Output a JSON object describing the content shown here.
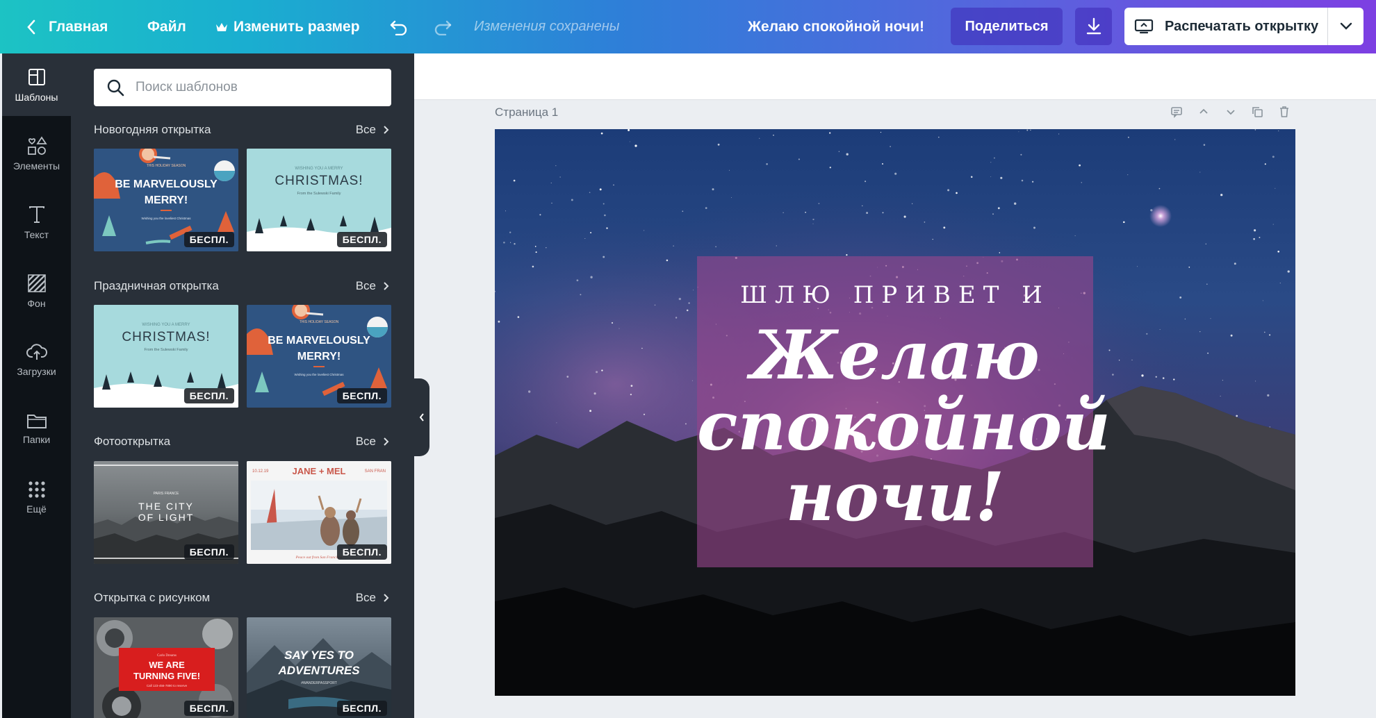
{
  "topbar": {
    "home_label": "Главная",
    "file_label": "Файл",
    "resize_label": "Изменить размер",
    "saved_status": "Изменения сохранены",
    "doc_title": "Желаю спокойной ночи!",
    "share_label": "Поделиться",
    "print_label": "Распечатать открытку"
  },
  "rail": {
    "items": [
      {
        "label": "Шаблоны",
        "icon": "templates-icon"
      },
      {
        "label": "Элементы",
        "icon": "elements-icon"
      },
      {
        "label": "Текст",
        "icon": "text-icon"
      },
      {
        "label": "Фон",
        "icon": "background-icon"
      },
      {
        "label": "Загрузки",
        "icon": "upload-icon"
      },
      {
        "label": "Папки",
        "icon": "folder-icon"
      },
      {
        "label": "Ещё",
        "icon": "more-icon"
      }
    ]
  },
  "panel": {
    "search_placeholder": "Поиск шаблонов",
    "all_label": "Все",
    "badge_label": "БЕСПЛ.",
    "sections": [
      {
        "title": "Новогодняя открытка"
      },
      {
        "title": "Праздничная открытка"
      },
      {
        "title": "Фотооткрытка"
      },
      {
        "title": "Открытка с рисунком"
      }
    ],
    "thumbs": {
      "merry_small": "THIS HOLIDAY SEASON",
      "merry_line1": "BE MARVELOUSLY",
      "merry_line2": "MERRY!",
      "merry_foot": "Wishing you the loveliest Christmas",
      "xmas_small": "WISHING YOU A MERRY",
      "xmas_big": "CHRISTMAS!",
      "xmas_foot": "From the Sulewski Family",
      "city_small": "PARIS FRANCE",
      "city_line1": "THE CITY",
      "city_line2": "OF LIGHT",
      "jm_date": "10.12.19",
      "jm_names": "JANE + MEL",
      "jm_place": "SAN FRAN",
      "jm_foot": "Peace out from San Francisco",
      "five_small": "Carlo Dreams",
      "five_line1": "WE ARE",
      "five_line2": "TURNING FIVE!",
      "five_foot": "Call 123-456-7890 to reserve",
      "adv_line1": "SAY YES TO",
      "adv_line2": "ADVENTURES",
      "adv_foot": "#WANDERPASSPORT"
    }
  },
  "canvas": {
    "page_label": "Страница 1",
    "greeting_small": "ШЛЮ ПРИВЕТ И",
    "greeting_line1": "Желаю",
    "greeting_line2": "спокойной",
    "greeting_line3": "ночи!"
  },
  "colors": {
    "accent_purple": "#7d3fe2",
    "accent_teal": "#1cc3c4",
    "panel_bg": "#293039",
    "rail_bg": "#0e1318"
  }
}
